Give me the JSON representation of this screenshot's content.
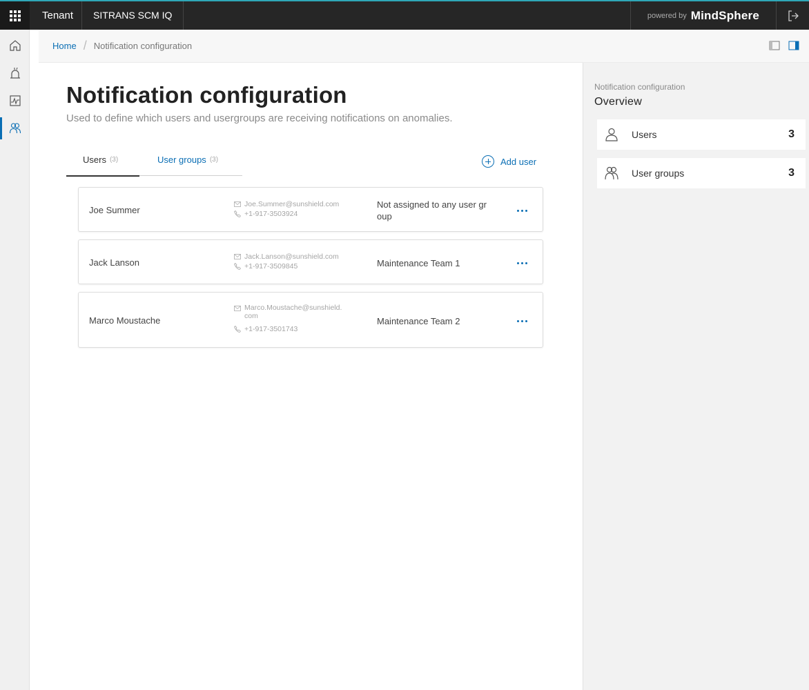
{
  "topbar": {
    "tenant": "Tenant",
    "app_name": "SITRANS SCM IQ",
    "powered_by": "powered by",
    "brand": "MindSphere"
  },
  "breadcrumb": {
    "home": "Home",
    "separator": "/",
    "current": "Notification configuration"
  },
  "page": {
    "title": "Notification configuration",
    "subtitle": "Used to define which users and usergroups are receiving notifications on anomalies."
  },
  "tabs": [
    {
      "label": "Users",
      "count": "(3)",
      "active": true
    },
    {
      "label": "User groups",
      "count": "(3)",
      "active": false
    }
  ],
  "add_user_label": "Add user",
  "users": [
    {
      "name": "Joe Summer",
      "email": "Joe.Summer@sunshield.com",
      "email_line2": "",
      "phone": "+1-917-3503924",
      "group_line1": "Not assigned to any user gr",
      "group_line2": "oup"
    },
    {
      "name": "Jack Lanson",
      "email": "Jack.Lanson@sunshield.com",
      "email_line2": "",
      "phone": "+1-917-3509845",
      "group_line1": "Maintenance Team 1",
      "group_line2": ""
    },
    {
      "name": "Marco Moustache",
      "email": "Marco.Moustache@sunshield.",
      "email_line2": "com",
      "phone": "+1-917-3501743",
      "group_line1": "Maintenance Team 2",
      "group_line2": ""
    }
  ],
  "overview": {
    "label": "Notification configuration",
    "title": "Overview",
    "items": [
      {
        "label": "Users",
        "value": "3",
        "icon": "user-icon"
      },
      {
        "label": "User groups",
        "value": "3",
        "icon": "user-group-icon"
      }
    ]
  },
  "colors": {
    "accent": "#0a6eb4",
    "topbar": "#262626",
    "topbar_border": "#2fa7b8",
    "panel_bg": "#f2f2f2"
  }
}
